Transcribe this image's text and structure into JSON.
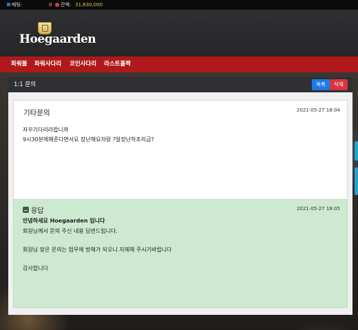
{
  "topbar": {
    "points_label": "배팅:",
    "points_value": "0",
    "balance_label": "잔액:",
    "balance_value": "31,830,000"
  },
  "logo": {
    "text": "Hoegaarden"
  },
  "nav": {
    "items": [
      {
        "label": "파워볼"
      },
      {
        "label": "파워사다리"
      },
      {
        "label": "코인사다리"
      },
      {
        "label": "라스트홀짝"
      }
    ]
  },
  "panel": {
    "title": "1:1 문의",
    "list_button": "목록",
    "delete_button": "삭제"
  },
  "question": {
    "title": "기타문의",
    "date": "2021-05-27 18:04",
    "line1": "자꾸기다리라합니까",
    "line2": "9시30분에해준다면서요 장난해요저랑 ?알장난하조지금?"
  },
  "answer": {
    "title": "응답",
    "date": "2021-05-27 18:05",
    "greeting": "안녕하세요 Hoegaarden 입니다",
    "line1": "회원님께서 문의 주신 내용 답변드립니다.",
    "line2": "회원님 잦은 문의는 업무에 방해가 되오니 자제해 주시기바랍니다",
    "line3": "감사합니다"
  },
  "colors": {
    "nav_red": "#b0191b",
    "list_blue": "#1d7be6",
    "delete_red": "#d9343e",
    "answer_green": "#cde9cf"
  }
}
